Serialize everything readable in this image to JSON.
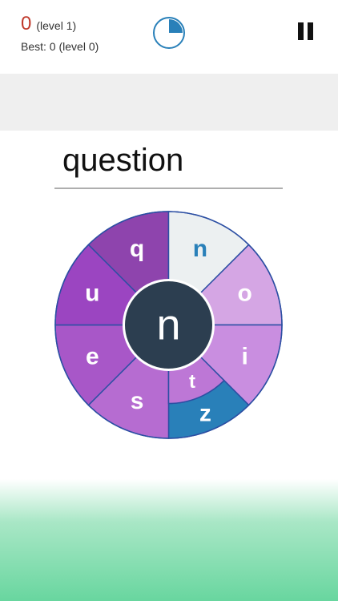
{
  "header": {
    "score": "0",
    "score_level": "(level 1)",
    "best": "Best: 0 (level 0)",
    "timer_progress": 0.25,
    "timer_icon": "pie-timer-icon",
    "pause_icon": "pause-icon"
  },
  "answer": {
    "text": "question"
  },
  "wheel": {
    "center_letter": "n",
    "center_color": "#2c3e50",
    "segments": [
      {
        "letter": "q",
        "color": "#8e44ad"
      },
      {
        "letter": "n",
        "color": "#ecf0f1",
        "text_color": "#2980b9"
      },
      {
        "letter": "o",
        "color": "#d5a6e4"
      },
      {
        "letter": "i",
        "color": "#c98ee0"
      },
      {
        "letter": "z",
        "color": "#2980b9"
      },
      {
        "letter": "s",
        "color": "#b66cd1"
      },
      {
        "letter": "e",
        "color": "#a857c8"
      },
      {
        "letter": "u",
        "color": "#9b45c1"
      }
    ],
    "inner_segment": {
      "letter": "t",
      "color": "#bd77d6"
    }
  },
  "colors": {
    "accent_red": "#c0392b",
    "blue": "#2980b9",
    "outline": "#2c4fa3"
  }
}
